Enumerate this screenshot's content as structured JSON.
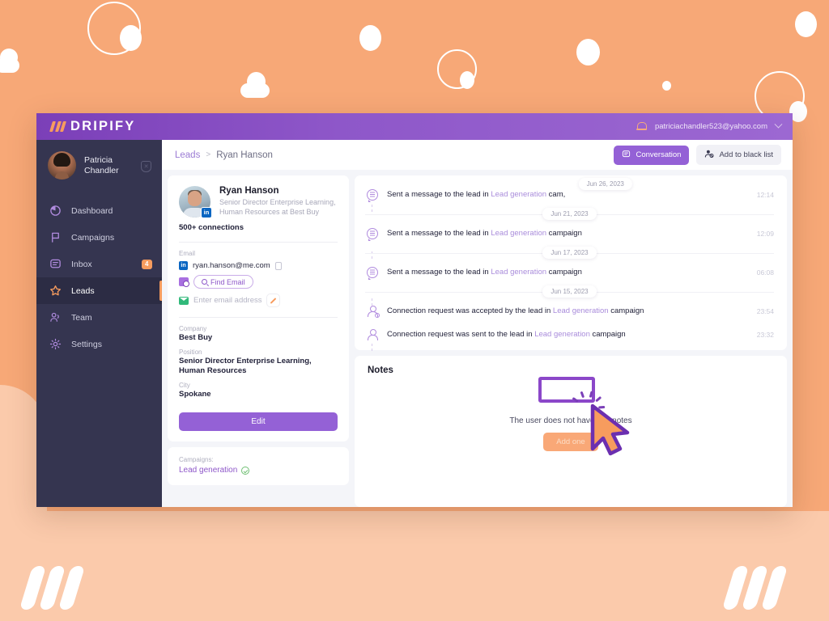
{
  "app": {
    "brand_name": "DRIPIFY",
    "user_email": "patriciachandler523@yahoo.com"
  },
  "sidebar": {
    "profile": {
      "name_line1": "Patricia",
      "name_line2": "Chandler",
      "badge_icon": "shield-icon"
    },
    "items": [
      {
        "label": "Dashboard",
        "icon": "pie-chart-icon",
        "active": false,
        "badge": ""
      },
      {
        "label": "Campaigns",
        "icon": "flag-icon",
        "active": false,
        "badge": ""
      },
      {
        "label": "Inbox",
        "icon": "chat-icon",
        "active": false,
        "badge": "4"
      },
      {
        "label": "Leads",
        "icon": "star-icon",
        "active": true,
        "badge": ""
      },
      {
        "label": "Team",
        "icon": "people-icon",
        "active": false,
        "badge": ""
      },
      {
        "label": "Settings",
        "icon": "gear-icon",
        "active": false,
        "badge": ""
      }
    ]
  },
  "breadcrumb": {
    "root": "Leads",
    "separator": ">",
    "current": "Ryan Hanson",
    "conversation_button": "Conversation",
    "blacklist_button": "Add to black list"
  },
  "lead": {
    "name": "Ryan Hanson",
    "headline": "Senior Director Enterprise Learning, Human Resources at Best Buy",
    "connections": "500+ connections",
    "email_section_label": "Email",
    "email_value": "ryan.hanson@me.com",
    "find_email_button": "Find Email",
    "email_input_placeholder": "Enter email address",
    "fields": [
      {
        "label": "Company",
        "value": "Best Buy"
      },
      {
        "label": "Position",
        "value": "Senior Director Enterprise Learning, Human Resources"
      },
      {
        "label": "City",
        "value": "Spokane"
      }
    ],
    "edit_button": "Edit",
    "campaigns_label": "Campaigns:",
    "campaign_name": "Lead generation"
  },
  "timeline": {
    "entries": [
      {
        "type": "message",
        "text_before": "Sent a message to the lead in ",
        "link": "Lead generation",
        "text_after": " cam,",
        "time": "12:14",
        "date_chip": "Jun 26, 2023",
        "chip_floating": true
      },
      {
        "type": "message",
        "text_before": "Sent a message to the lead in ",
        "link": "Lead generation",
        "text_after": " campaign",
        "time": "12:09",
        "date_chip": "Jun 21, 2023",
        "chip_floating": false
      },
      {
        "type": "message",
        "text_before": "Sent a message to the lead in ",
        "link": "Lead generation",
        "text_after": " campaign",
        "time": "06:08",
        "date_chip": "Jun 17, 2023",
        "chip_floating": false
      },
      {
        "type": "connection-accepted",
        "text_before": "Connection request was accepted by the lead in ",
        "link": "Lead generation",
        "text_after": " campaign",
        "time": "23:54",
        "date_chip": "Jun 15, 2023",
        "chip_floating": false
      },
      {
        "type": "connection-sent",
        "text_before": "Connection request was sent to the lead in ",
        "link": "Lead generation",
        "text_after": " campaign",
        "time": "23:32",
        "date_chip": "",
        "chip_floating": false
      }
    ]
  },
  "notes": {
    "title": "Notes",
    "empty_message": "The user does not have any notes",
    "add_button": "Add one"
  },
  "colors": {
    "brand_purple": "#8E57C9",
    "accent_orange": "#F79C5E",
    "sidebar_dark": "#353550",
    "page_background": "#F7A877",
    "highlight_outline": "#8B47C9"
  }
}
